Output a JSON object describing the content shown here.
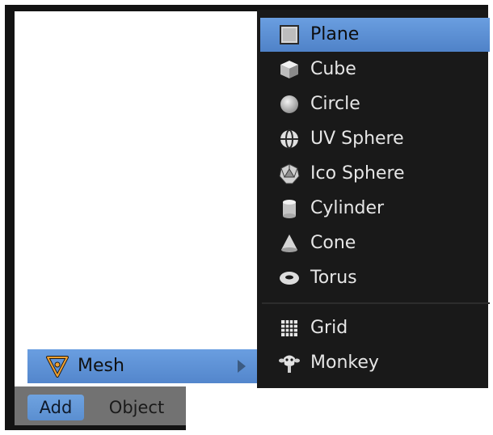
{
  "header": {
    "add_label": "Add",
    "object_label": "Object"
  },
  "add_menu": {
    "mesh_label": "Mesh",
    "mesh_icon": "mesh-icon"
  },
  "submenu": {
    "items": [
      {
        "label": "Plane",
        "icon": "plane-icon",
        "active": true
      },
      {
        "label": "Cube",
        "icon": "cube-icon"
      },
      {
        "label": "Circle",
        "icon": "circle-icon"
      },
      {
        "label": "UV Sphere",
        "icon": "uv-sphere-icon"
      },
      {
        "label": "Ico Sphere",
        "icon": "ico-sphere-icon"
      },
      {
        "label": "Cylinder",
        "icon": "cylinder-icon"
      },
      {
        "label": "Cone",
        "icon": "cone-icon"
      },
      {
        "label": "Torus",
        "icon": "torus-icon"
      },
      {
        "label": "Grid",
        "icon": "grid-icon"
      },
      {
        "label": "Monkey",
        "icon": "monkey-icon"
      }
    ]
  },
  "colors": {
    "highlight": "#5a8ed0",
    "menu_bg": "#191919",
    "header_bg": "#727272",
    "mesh_icon_orange": "#f0a030"
  }
}
